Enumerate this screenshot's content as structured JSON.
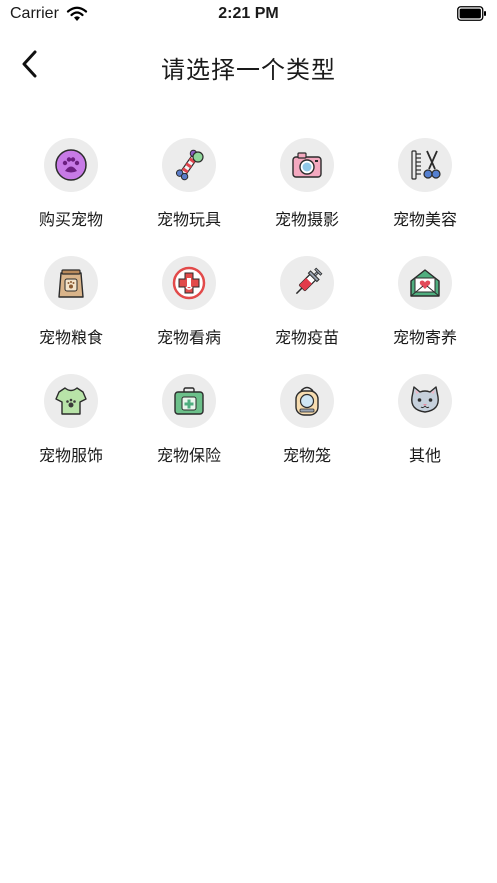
{
  "status_bar": {
    "carrier": "Carrier",
    "time": "2:21 PM"
  },
  "header": {
    "title": "请选择一个类型",
    "back_icon": "chevron-left-icon"
  },
  "categories": [
    {
      "label": "购买宠物",
      "icon": "paw-icon",
      "color": "#b23bd9"
    },
    {
      "label": "宠物玩具",
      "icon": "bone-toy-icon",
      "color": "#8a5cc0"
    },
    {
      "label": "宠物摄影",
      "icon": "camera-icon",
      "color": "#f09ab5"
    },
    {
      "label": "宠物美容",
      "icon": "comb-scissors-icon",
      "color": "#5580d0"
    },
    {
      "label": "宠物粮食",
      "icon": "food-bag-icon",
      "color": "#c49a6c"
    },
    {
      "label": "宠物看病",
      "icon": "medical-cross-icon",
      "color": "#e24a4a"
    },
    {
      "label": "宠物疫苗",
      "icon": "syringe-icon",
      "color": "#e23a4a"
    },
    {
      "label": "宠物寄养",
      "icon": "house-heart-icon",
      "color": "#4fae7f"
    },
    {
      "label": "宠物服饰",
      "icon": "shirt-icon",
      "color": "#a8d99a"
    },
    {
      "label": "宠物保险",
      "icon": "first-aid-kit-icon",
      "color": "#6cc08a"
    },
    {
      "label": "宠物笼",
      "icon": "pet-carrier-icon",
      "color": "#f2d2a0"
    },
    {
      "label": "其他",
      "icon": "cat-face-icon",
      "color": "#a7b4c4"
    }
  ]
}
